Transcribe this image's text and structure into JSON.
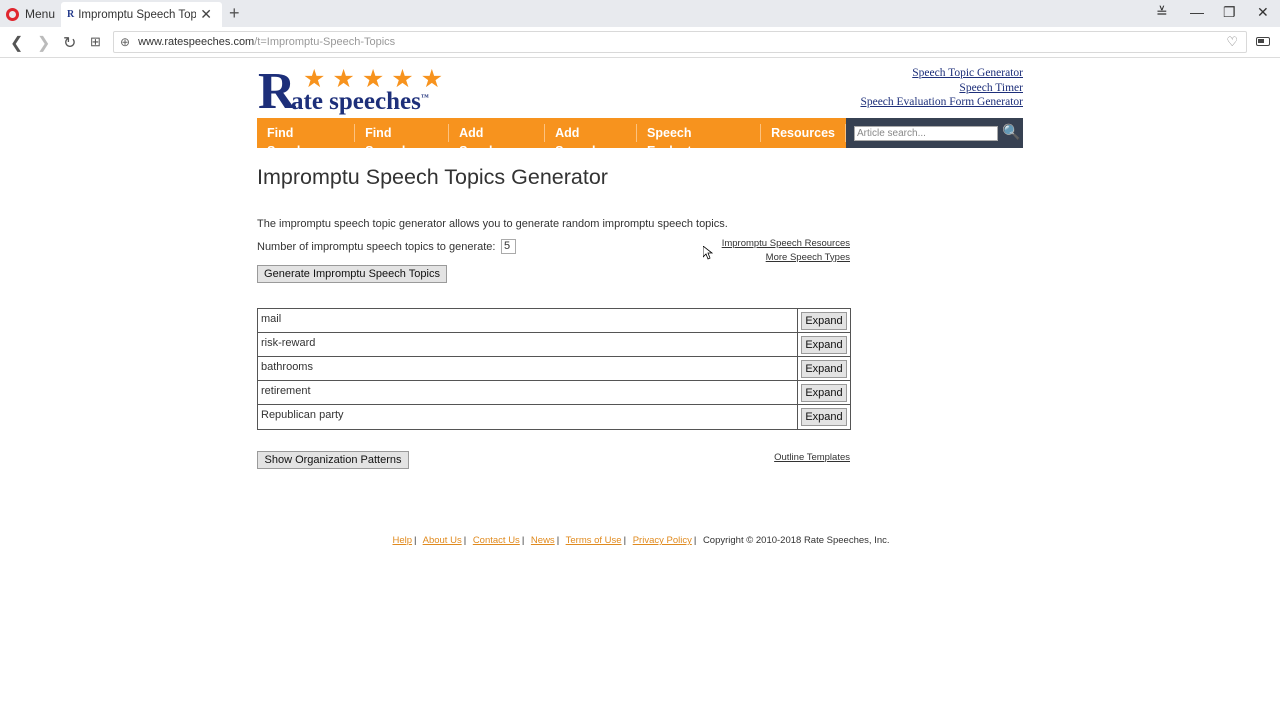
{
  "browser": {
    "menu_label": "Menu",
    "tab_title": "Impromptu Speech Topics",
    "url_domain": "www.ratespeeches.com",
    "url_path": "/t=Impromptu-Speech-Topics"
  },
  "logo": {
    "letter": "R",
    "stars": "★★★★★",
    "word": "ate speeches",
    "tm": "™"
  },
  "top_links": [
    "Speech Topic Generator",
    "Speech Timer",
    "Speech Evaluation Form Generator"
  ],
  "nav": [
    "Find Speaker",
    "Find Speech",
    "Add Speaker",
    "Add Speech",
    "Speech Evaluator",
    "Resources"
  ],
  "search": {
    "placeholder": "Article search..."
  },
  "page": {
    "title": "Impromptu Speech Topics Generator",
    "intro": "The impromptu speech topic generator allows you to generate random impromptu speech topics.",
    "count_label": "Number of impromptu speech topics to generate:",
    "count_value": "5",
    "side_links": [
      "Impromptu Speech Resources",
      "More Speech Types"
    ],
    "generate_button": "Generate Impromptu Speech Topics",
    "expand_label": "Expand",
    "topics": [
      "mail",
      "risk-reward",
      "bathrooms",
      "retirement",
      "Republican party"
    ],
    "org_button": "Show Organization Patterns",
    "outline_link": "Outline Templates"
  },
  "footer": {
    "links": [
      "Help",
      "About Us",
      "Contact Us",
      "News",
      "Terms of Use",
      "Privacy Policy"
    ],
    "copyright": "Copyright © 2010-2018 Rate Speeches, Inc."
  },
  "colors": {
    "accent_orange": "#f7931e",
    "brand_blue": "#1d2f7a",
    "search_bg": "#374152"
  }
}
